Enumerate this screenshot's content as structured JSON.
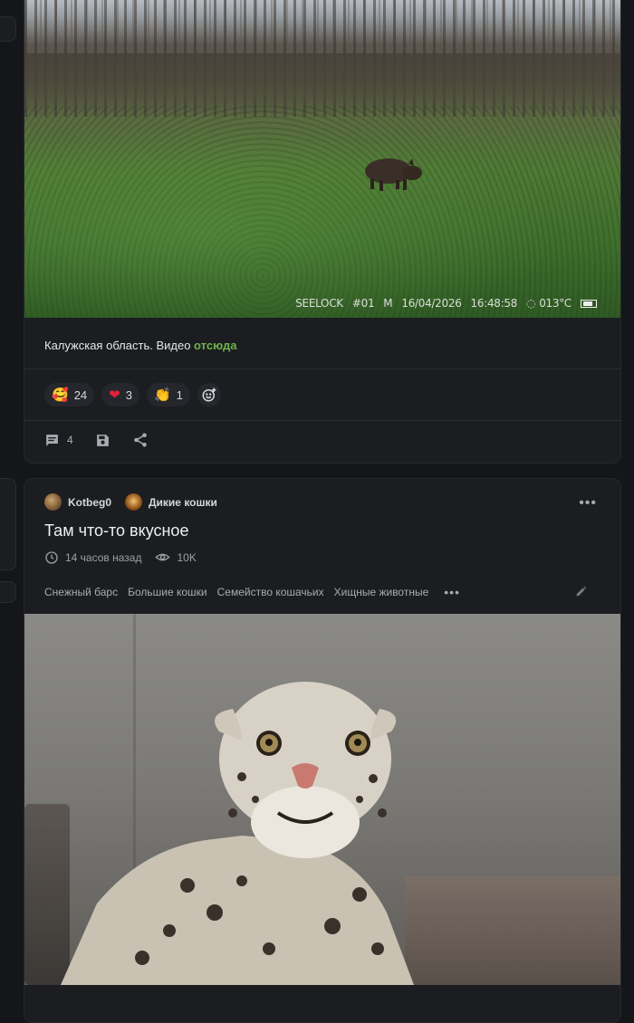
{
  "post1": {
    "photo_alt": "camera-trap photo of wild boar in meadow",
    "stamp": {
      "brand": "SEELOCK",
      "camera": "#01",
      "mode": "M",
      "date": "16/04/2026",
      "time": "16:48:58",
      "temp": "013°C"
    },
    "caption_text": "Калужская область. Видео ",
    "caption_link": "отсюда",
    "reactions": [
      {
        "emoji": "🥰",
        "count": "24"
      },
      {
        "emoji": "❤",
        "count": "3"
      },
      {
        "emoji": "👏",
        "count": "1"
      }
    ],
    "comments_count": "4"
  },
  "post2": {
    "author": "Kotbeg0",
    "community": "Дикие кошки",
    "title": "Там что-то вкусное",
    "time_ago": "14 часов назад",
    "views": "10K",
    "tags": [
      "Снежный барс",
      "Большие кошки",
      "Семейство кошачьих",
      "Хищные животные"
    ],
    "photo_alt": "snow leopard looking up"
  },
  "colors": {
    "background": "#151619",
    "card": "#1c1d21",
    "link": "#6fb34a",
    "muted": "#a9abb1"
  }
}
